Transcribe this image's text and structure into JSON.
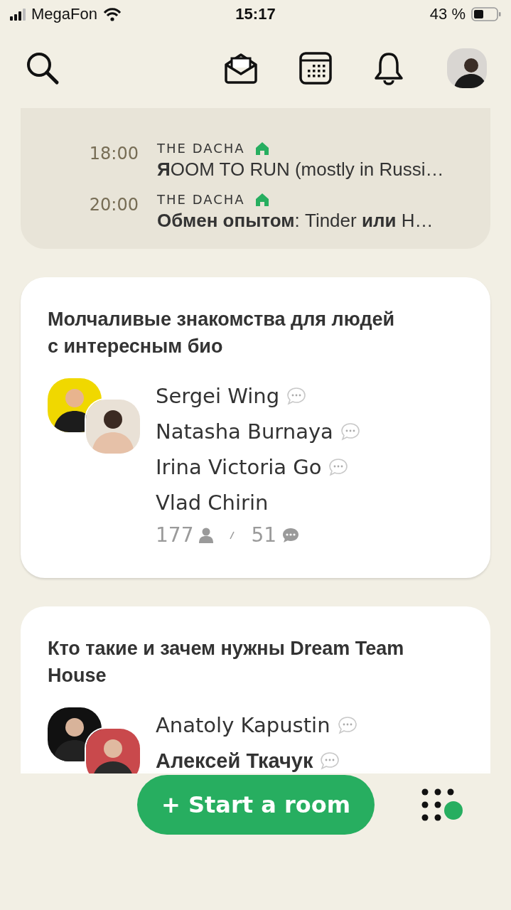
{
  "status_bar": {
    "carrier": "MegaFon",
    "time": "15:17",
    "battery": "43 %"
  },
  "events": [
    {
      "time": "18:00",
      "club": "THE DACHA",
      "club_home": true,
      "title": "**Я**OOM TO RUN (mostly in Russi…"
    },
    {
      "time": "20:00",
      "club": "THE DACHA",
      "club_home": true,
      "title": "**Обмен опытом**: Tinder **или** Н…"
    }
  ],
  "rooms": [
    {
      "title": "Молчаливые знакомства для людей с интересным био",
      "speakers": [
        {
          "name": "Sergei Wing",
          "bold": false,
          "speaker": true
        },
        {
          "name": "Natasha Burnaya",
          "bold": false,
          "speaker": true
        },
        {
          "name": "Irina Victoria Go",
          "bold": false,
          "speaker": true
        },
        {
          "name": "Vlad Chirin",
          "bold": false,
          "speaker": false
        }
      ],
      "listeners": "177",
      "messages": "51"
    },
    {
      "title": "**Кто такие и зачем нужны** Dream Team House",
      "speakers": [
        {
          "name": "Anatoly Kapustin",
          "bold": false,
          "speaker": true
        },
        {
          "name": "Алексей Ткачук",
          "bold": true,
          "speaker": true
        }
      ]
    }
  ],
  "start_button": {
    "label": "+ Start a room"
  }
}
